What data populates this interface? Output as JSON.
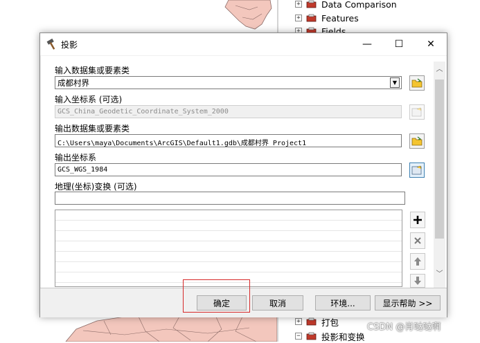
{
  "tree": {
    "items": [
      {
        "label": "Data Comparison",
        "expand": "+"
      },
      {
        "label": "Features",
        "expand": "+"
      },
      {
        "label": "Fields",
        "expand": "+"
      },
      {
        "label": "打包",
        "expand": "+"
      },
      {
        "label": "投影和变换",
        "expand": "−"
      }
    ]
  },
  "dialog": {
    "title": "投影",
    "window_buttons": {
      "minimize": "—",
      "maximize": "☐",
      "close": "✕"
    },
    "input_dataset": {
      "label": "输入数据集或要素类",
      "value": "成都村界"
    },
    "input_crs": {
      "label": "输入坐标系 (可选)",
      "value": "GCS_China_Geodetic_Coordinate_System_2000"
    },
    "output_dataset": {
      "label": "输出数据集或要素类",
      "value": "C:\\Users\\maya\\Documents\\ArcGIS\\Default1.gdb\\成都村界_Project1"
    },
    "output_crs": {
      "label": "输出坐标系",
      "value": "GCS_WGS_1984"
    },
    "geo_transform": {
      "label": "地理(坐标)变换 (可选)",
      "value": ""
    },
    "buttons": {
      "ok": "确定",
      "cancel": "取消",
      "environments": "环境...",
      "show_help": "显示帮助 >>"
    }
  },
  "watermark": "CSDN @肖哒哒啊",
  "colors": {
    "map_fill": "#f3c7bd",
    "map_stroke": "#8a6a66",
    "highlight_box": "#d62828",
    "folder_yellow": "#f4c430"
  }
}
